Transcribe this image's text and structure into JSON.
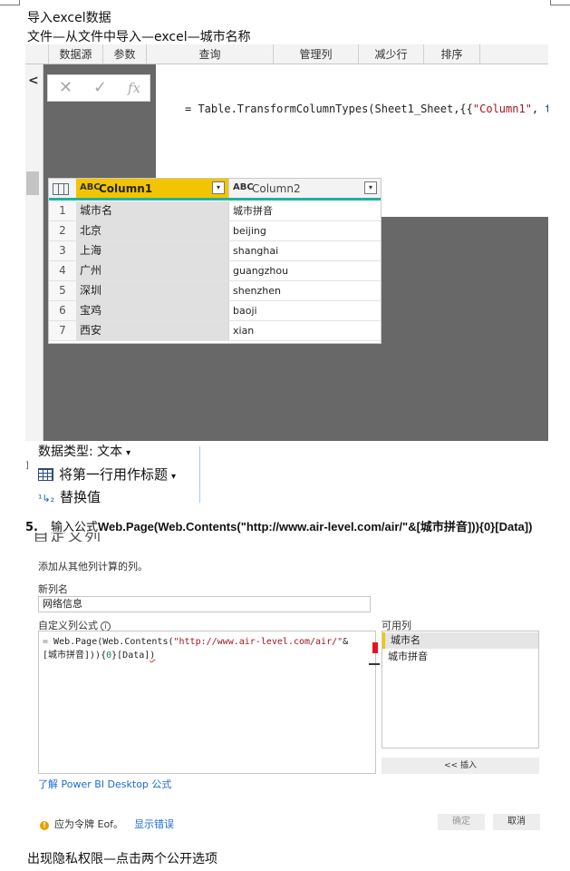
{
  "doc": {
    "heading": "导入excel数据",
    "subheading": "文件—从文件中导入—excel—城市名称",
    "step5_number": "5.",
    "step5_prefix": "输入公式",
    "step5_formula": "Web.Page(Web.Contents(\"http://www.air-level.com/air/\"&[城市拼音])){0}[Data])",
    "footer": "出现隐私权限—点击两个公开选项"
  },
  "power_query": {
    "ribbon_groups": [
      "数据源",
      "参数",
      "查询",
      "管理列",
      "减少行",
      "排序"
    ],
    "collapse_glyph": "<",
    "formula_icons": {
      "cancel": "✕",
      "confirm": "✓",
      "fx": "fx"
    },
    "formula_bar": {
      "prefix": "= Table.TransformColumnTypes(Sheet1_Sheet,{{",
      "string": "\"Column1\"",
      "sep": ", ",
      "keyword": "type"
    },
    "columns": [
      {
        "type_glyph": "ABC",
        "name": "Column1",
        "dropdown": "▾"
      },
      {
        "type_glyph": "ABC",
        "name": "Column2",
        "dropdown": "▾"
      }
    ],
    "rows": [
      {
        "n": "1",
        "c1": "城市名",
        "c2": "城市拼音"
      },
      {
        "n": "2",
        "c1": "北京",
        "c2": "beijing"
      },
      {
        "n": "3",
        "c1": "上海",
        "c2": "shanghai"
      },
      {
        "n": "4",
        "c1": "广州",
        "c2": "guangzhou"
      },
      {
        "n": "5",
        "c1": "深圳",
        "c2": "shenzhen"
      },
      {
        "n": "6",
        "c1": "宝鸡",
        "c2": "baoji"
      },
      {
        "n": "7",
        "c1": "西安",
        "c2": "xian"
      }
    ]
  },
  "menu": {
    "data_type": "数据类型: 文本",
    "first_row_header": "将第一行用作标题",
    "replace_values": "替换值",
    "replace_icon": "¹↳₂",
    "caret": "▾",
    "left_bracket": "]"
  },
  "dialog": {
    "title_partial": "自定义列",
    "subtitle": "添加从其他列计算的列。",
    "new_col_label": "新列名",
    "new_col_value": "网络信息",
    "formula_label": "自定义列公式",
    "info_glyph": "i",
    "formula_eq": "= ",
    "formula_pre": "Web.Page(Web.Contents(",
    "formula_url": "\"http://www.air-level.com/air/\"",
    "formula_amp": "&[城市拼音])){",
    "formula_zero": "0",
    "formula_post": "}[Data]",
    "formula_tail": ")",
    "available_label": "可用列",
    "available_columns": [
      "城市名",
      "城市拼音"
    ],
    "insert_button": "<< 插入",
    "learn_link": "了解 Power BI Desktop 公式",
    "warning_glyph": "!",
    "warning_text": "应为令牌 Eof。",
    "show_error": "显示错误",
    "ok_button": "确定",
    "cancel_button": "取消"
  },
  "colors": {
    "accent_yellow": "#f2c500",
    "accent_teal": "#1fb1a1",
    "link_blue": "#1a6bd6",
    "error_red": "#e81123"
  }
}
